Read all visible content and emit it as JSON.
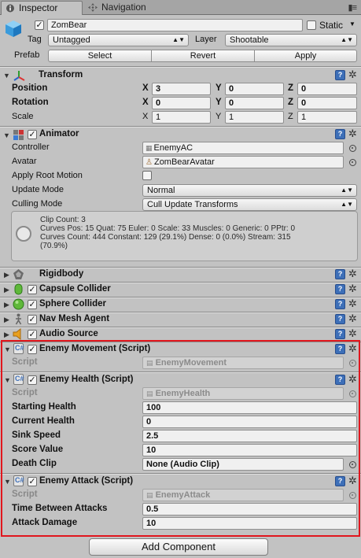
{
  "tabs": [
    {
      "label": "Inspector",
      "icon": "info-icon"
    },
    {
      "label": "Navigation",
      "icon": "navigation-icon"
    }
  ],
  "object": {
    "name": "ZomBear",
    "static_label": "Static",
    "tag_label": "Tag",
    "tag_value": "Untagged",
    "layer_label": "Layer",
    "layer_value": "Shootable",
    "prefab_label": "Prefab",
    "prefab_buttons": [
      "Select",
      "Revert",
      "Apply"
    ]
  },
  "transform": {
    "title": "Transform",
    "rows": [
      {
        "label": "Position",
        "x": "3",
        "y": "0",
        "z": "0"
      },
      {
        "label": "Rotation",
        "x": "0",
        "y": "0",
        "z": "0"
      },
      {
        "label": "Scale",
        "x": "1",
        "y": "1",
        "z": "1"
      }
    ],
    "axes": [
      "X",
      "Y",
      "Z"
    ]
  },
  "animator": {
    "title": "Animator",
    "controller_label": "Controller",
    "controller_value": "EnemyAC",
    "avatar_label": "Avatar",
    "avatar_value": "ZomBearAvatar",
    "apply_root_motion_label": "Apply Root Motion",
    "update_mode_label": "Update Mode",
    "update_mode_value": "Normal",
    "culling_mode_label": "Culling Mode",
    "culling_mode_value": "Cull Update Transforms",
    "info": "Clip Count: 3\nCurves Pos: 15 Quat: 75 Euler: 0 Scale: 33 Muscles: 0 Generic: 0 PPtr: 0\nCurves Count: 444 Constant: 129 (29.1%) Dense: 0 (0.0%) Stream: 315\n(70.9%)"
  },
  "collapsed_components": [
    {
      "title": "Rigidbody",
      "icon": "rigidbody-icon",
      "checkbox": false
    },
    {
      "title": "Capsule Collider",
      "icon": "capsule-collider-icon",
      "checkbox": true
    },
    {
      "title": "Sphere Collider",
      "icon": "sphere-collider-icon",
      "checkbox": true
    },
    {
      "title": "Nav Mesh Agent",
      "icon": "nav-mesh-agent-icon",
      "checkbox": true
    },
    {
      "title": "Audio Source",
      "icon": "audio-source-icon",
      "checkbox": true
    }
  ],
  "enemy_movement": {
    "title": "Enemy Movement (Script)",
    "script_label": "Script",
    "script_value": "EnemyMovement"
  },
  "enemy_health": {
    "title": "Enemy Health (Script)",
    "script_label": "Script",
    "script_value": "EnemyHealth",
    "fields": [
      {
        "label": "Starting Health",
        "value": "100"
      },
      {
        "label": "Current Health",
        "value": "0"
      },
      {
        "label": "Sink Speed",
        "value": "2.5"
      },
      {
        "label": "Score Value",
        "value": "10"
      },
      {
        "label": "Death Clip",
        "value": "None (Audio Clip)"
      }
    ]
  },
  "enemy_attack": {
    "title": "Enemy Attack (Script)",
    "script_label": "Script",
    "script_value": "EnemyAttack",
    "fields": [
      {
        "label": "Time Between Attacks",
        "value": "0.5"
      },
      {
        "label": "Attack Damage",
        "value": "10"
      }
    ]
  },
  "add_component_label": "Add Component",
  "colors": {
    "panel": "#c2c2c2",
    "highlight": "#e1161d",
    "help_icon": "#3d6fb8"
  }
}
